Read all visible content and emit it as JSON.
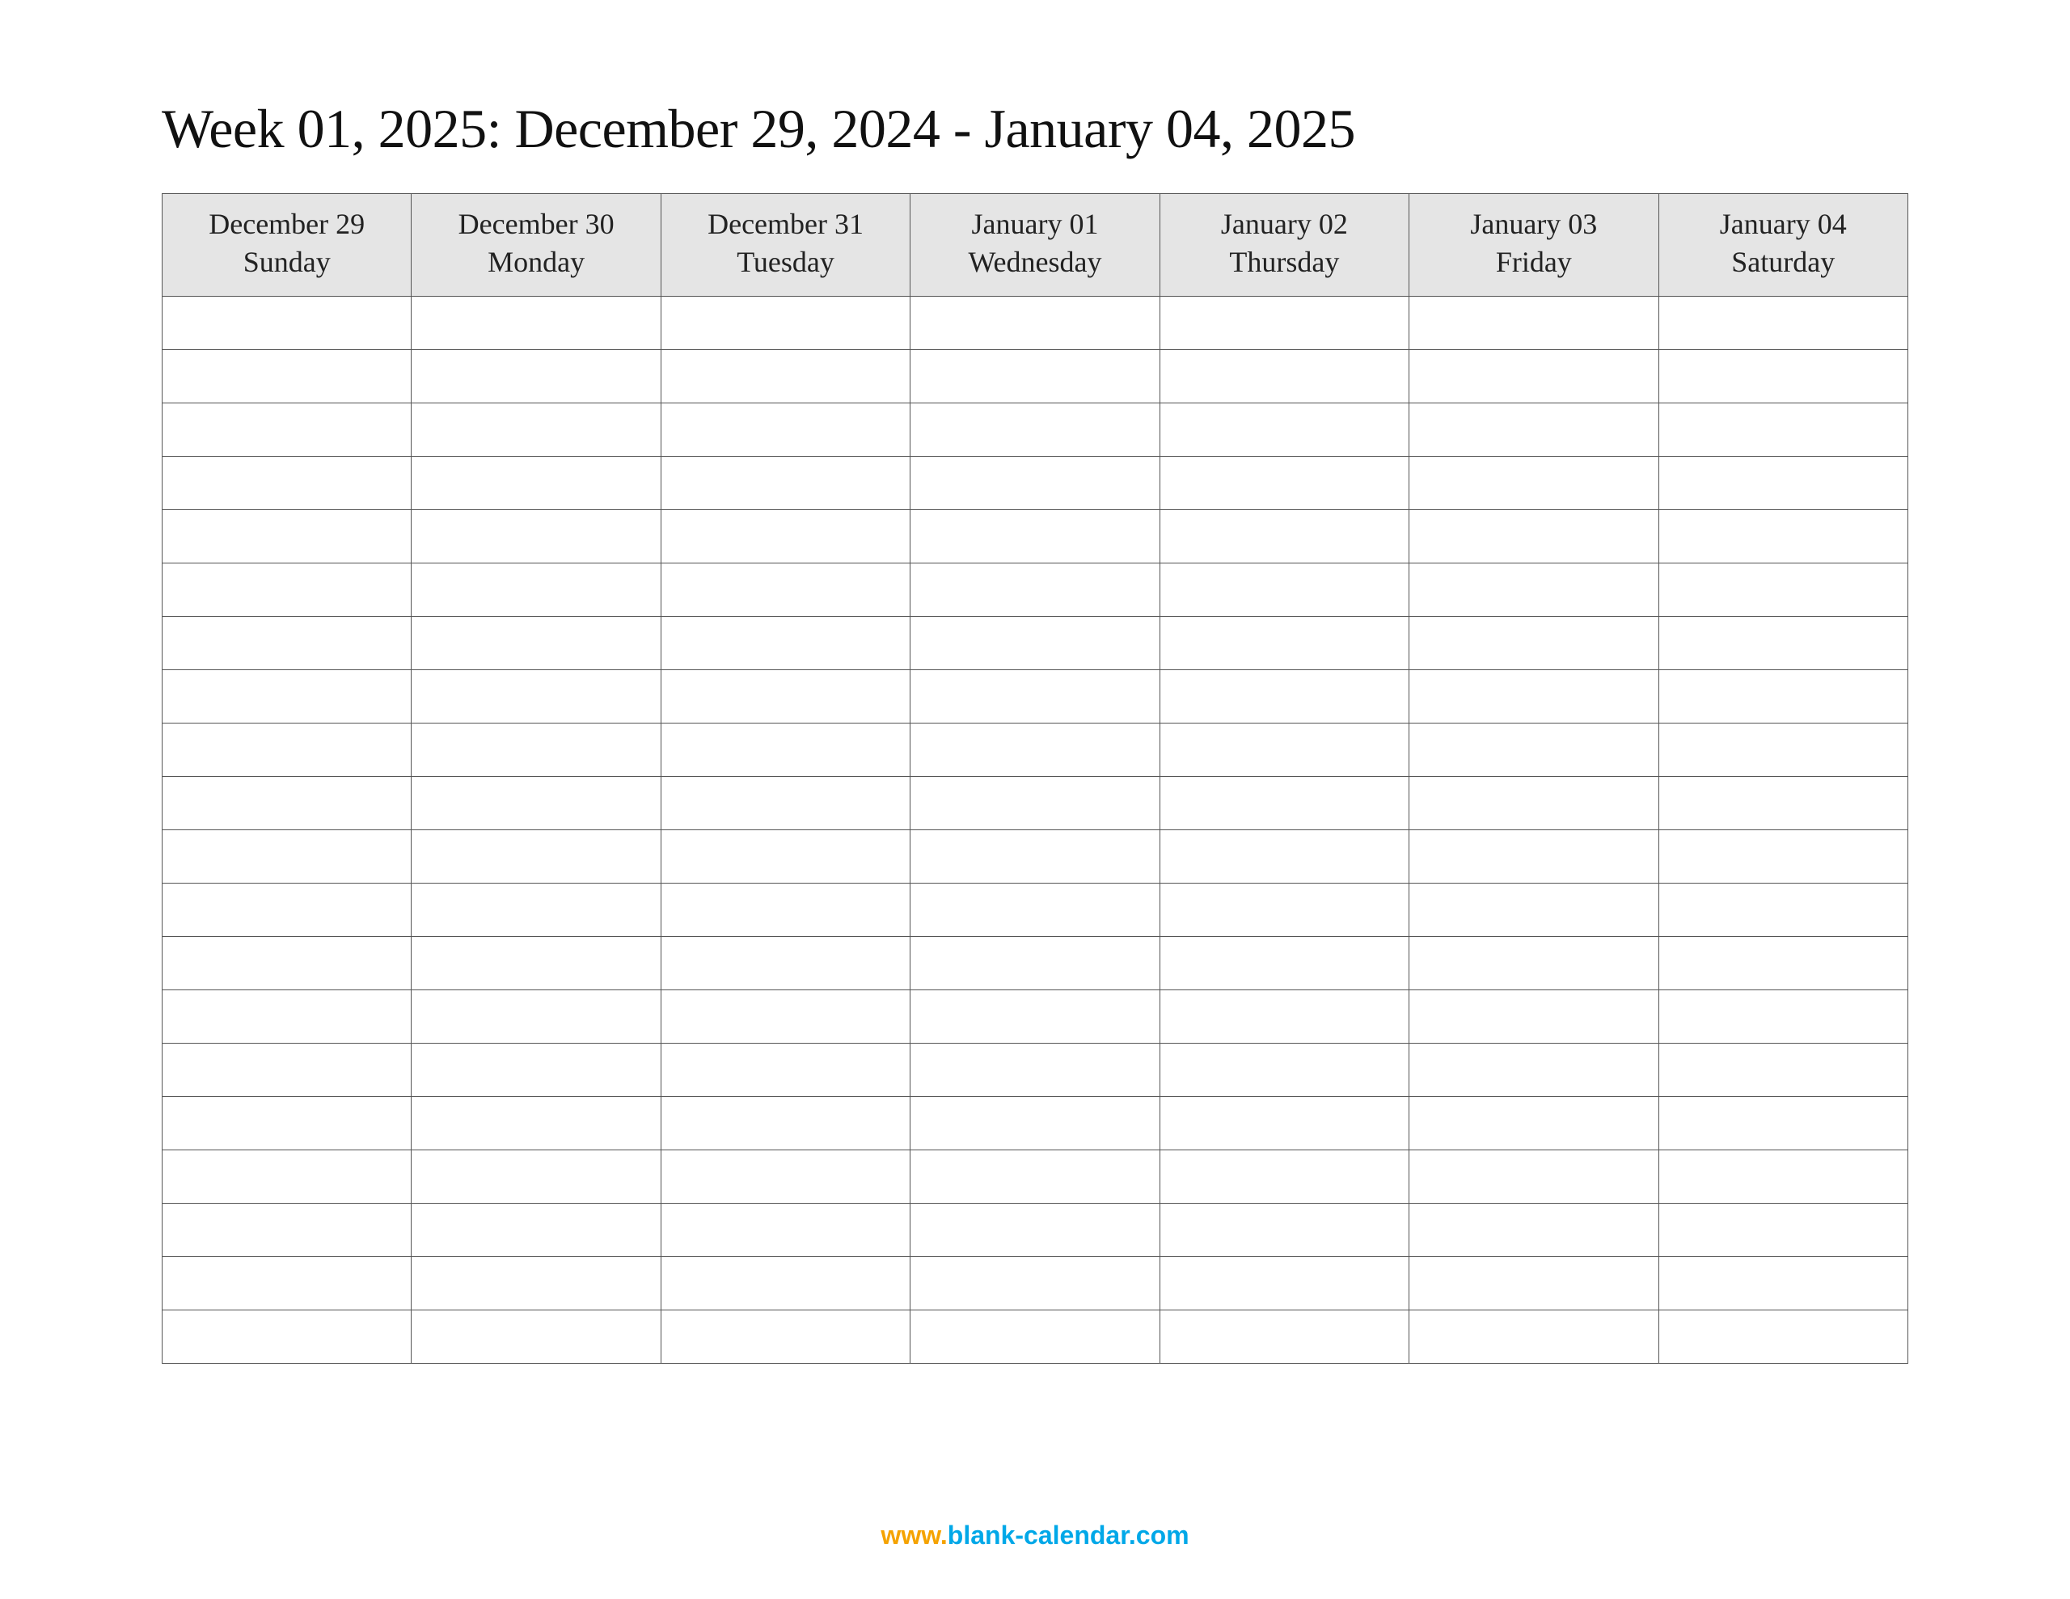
{
  "title": "Week 01, 2025: December 29, 2024 - January 04, 2025",
  "days": [
    {
      "date": "December 29",
      "day": "Sunday"
    },
    {
      "date": "December 30",
      "day": "Monday"
    },
    {
      "date": "December 31",
      "day": "Tuesday"
    },
    {
      "date": "January 01",
      "day": "Wednesday"
    },
    {
      "date": "January 02",
      "day": "Thursday"
    },
    {
      "date": "January 03",
      "day": "Friday"
    },
    {
      "date": "January 04",
      "day": "Saturday"
    }
  ],
  "rowCount": 20,
  "footer": {
    "www": "www.",
    "rest": "blank-calendar.com"
  }
}
